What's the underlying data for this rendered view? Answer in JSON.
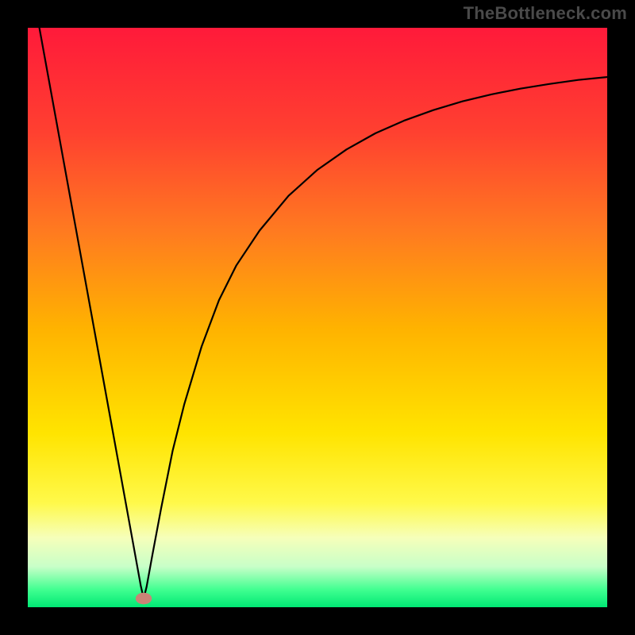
{
  "chart_data": {
    "type": "line",
    "title": "",
    "xlabel": "",
    "ylabel": "",
    "xlim": [
      0,
      100
    ],
    "ylim": [
      0,
      100
    ],
    "watermark": "TheBottleneck.com",
    "gradient_stops": [
      {
        "pos": 0.0,
        "color": "#ff1a3a"
      },
      {
        "pos": 0.18,
        "color": "#ff4030"
      },
      {
        "pos": 0.35,
        "color": "#ff7a20"
      },
      {
        "pos": 0.52,
        "color": "#ffb300"
      },
      {
        "pos": 0.7,
        "color": "#ffe400"
      },
      {
        "pos": 0.82,
        "color": "#fff94a"
      },
      {
        "pos": 0.88,
        "color": "#f6ffba"
      },
      {
        "pos": 0.93,
        "color": "#c8ffc8"
      },
      {
        "pos": 0.97,
        "color": "#40ff90"
      },
      {
        "pos": 1.0,
        "color": "#00e874"
      }
    ],
    "marker": {
      "x": 20,
      "y": 1.5,
      "color": "#c98476",
      "rx": 1.4,
      "ry": 1.0
    },
    "series": [
      {
        "name": "curve",
        "color": "#000000",
        "x": [
          2,
          4,
          6,
          8,
          10,
          12,
          14,
          16,
          18,
          19.5,
          20,
          20.5,
          21.5,
          23,
          25,
          27,
          30,
          33,
          36,
          40,
          45,
          50,
          55,
          60,
          65,
          70,
          75,
          80,
          85,
          90,
          95,
          100
        ],
        "y": [
          100,
          89.0,
          78.0,
          67.0,
          56.0,
          45.0,
          34.0,
          23.0,
          12.0,
          3.7,
          1.5,
          3.5,
          9.0,
          17.0,
          27.0,
          35.0,
          45.0,
          53.0,
          59.0,
          65.0,
          71.0,
          75.5,
          79.0,
          81.8,
          84.0,
          85.8,
          87.3,
          88.5,
          89.5,
          90.3,
          91.0,
          91.5
        ]
      }
    ]
  }
}
